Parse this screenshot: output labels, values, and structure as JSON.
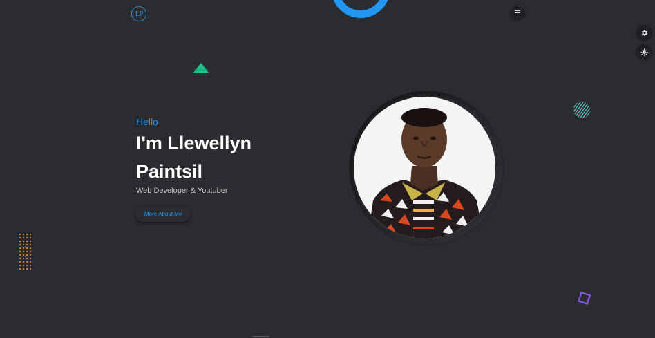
{
  "header": {
    "logo_text": "LP",
    "menu_icon": "hamburger-icon"
  },
  "side_controls": {
    "settings_icon": "gear-icon",
    "theme_icon": "sun-icon"
  },
  "hero": {
    "greeting": "Hello",
    "name_line1": "I'm Llewellyn",
    "name_line2": "Paintsil",
    "role": "Web Developer & Youtuber",
    "cta_label": "More About Me"
  },
  "colors": {
    "background": "#2b2c2f",
    "accent": "#2196f3",
    "triangle": "#1fc38b",
    "dots": "#f0a230",
    "square": "#8a55f0",
    "stripes": "#5fc7c0"
  }
}
